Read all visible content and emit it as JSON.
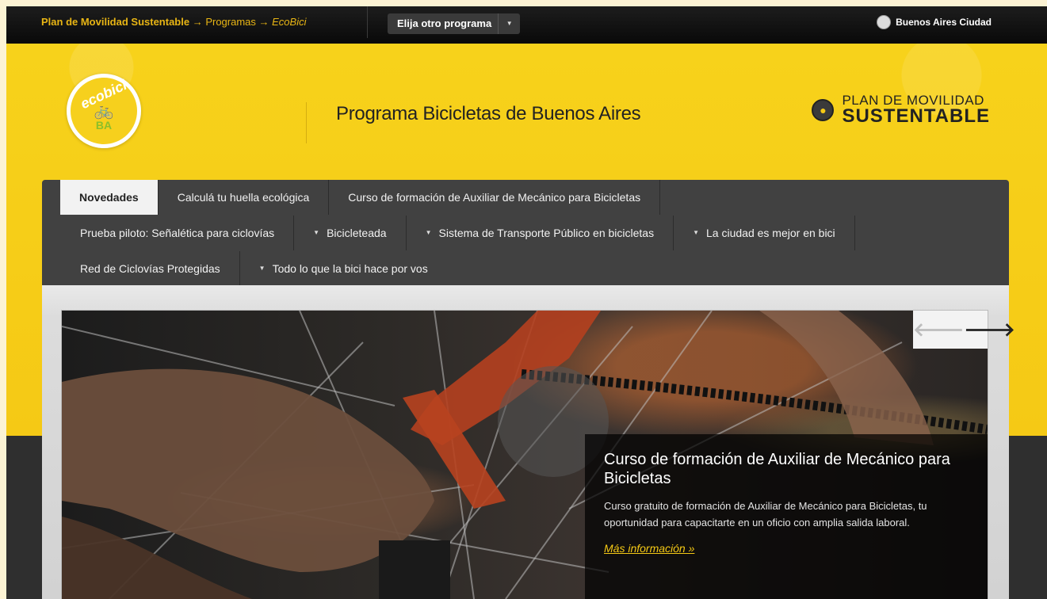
{
  "topbar": {
    "breadcrumb": {
      "root": "Plan de Movilidad Sustentable",
      "arrow1": " → ",
      "programs": "Programas",
      "arrow2": " → ",
      "current": "EcoBici"
    },
    "program_select_label": "Elija otro programa",
    "city_brand": "Buenos Aires Ciudad"
  },
  "header": {
    "logo": {
      "top": "ecobici",
      "bottom": "BA"
    },
    "site_title": "Programa Bicicletas de Buenos Aires",
    "pms_line1": "PLAN DE MOVILIDAD",
    "pms_line2": "SUSTENTABLE"
  },
  "nav": {
    "row1": [
      {
        "label": "Novedades",
        "active": true
      },
      {
        "label": "Calculá tu huella ecológica"
      },
      {
        "label": "Curso de formación de Auxiliar de Mecánico para Bicicletas"
      }
    ],
    "row2": [
      {
        "label": "Prueba piloto: Señalética para ciclovías"
      },
      {
        "label": "Bicicleteada",
        "dropdown": true
      },
      {
        "label": "Sistema de Transporte Público en bicicletas",
        "dropdown": true
      },
      {
        "label": "La ciudad es mejor en bici",
        "dropdown": true
      }
    ],
    "row3": [
      {
        "label": "Red de Ciclovías Protegidas"
      },
      {
        "label": "Todo lo que la bici hace por vos",
        "dropdown": true
      }
    ]
  },
  "slider": {
    "prev_symbol": "🡐",
    "next_symbol": "🡒",
    "caption_title": "Curso de formación de Auxiliar de Mecánico para Bicicletas",
    "caption_text": "Curso gratuito de formación de Auxiliar de Mecánico para Bicicletas, tu oportunidad para capacitarte en un oficio con amplia salida laboral.",
    "more_link": "Más información »"
  },
  "colors": {
    "brand_yellow": "#f5c915",
    "breadcrumb_gold": "#e8b514",
    "nav_dark": "#414141"
  }
}
